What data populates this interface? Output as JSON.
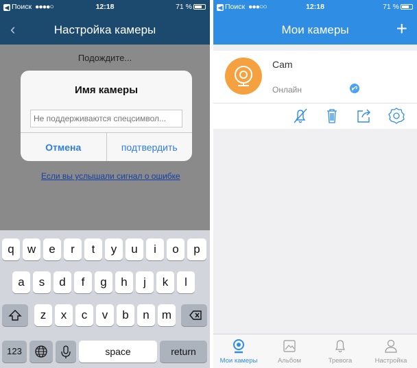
{
  "left": {
    "status": {
      "carrier_back": "Поиск",
      "signal": "●●●●○",
      "time": "12:18",
      "battery": "71 %"
    },
    "nav_title": "Настройка камеры",
    "waiting": "Подождите...",
    "dialog": {
      "title": "Имя камеры",
      "placeholder": "Не поддерживаются спецсимвол...",
      "cancel": "Отмена",
      "confirm": "подтвердить"
    },
    "error_link": "Если вы услышали сигнал о ошибке",
    "keyboard": {
      "row1": [
        "q",
        "w",
        "e",
        "r",
        "t",
        "y",
        "u",
        "i",
        "o",
        "p"
      ],
      "row2": [
        "a",
        "s",
        "d",
        "f",
        "g",
        "h",
        "j",
        "k",
        "l"
      ],
      "row3": [
        "z",
        "x",
        "c",
        "v",
        "b",
        "n",
        "m"
      ],
      "numbers": "123",
      "space": "space",
      "return": "return"
    }
  },
  "right": {
    "status": {
      "carrier_back": "Поиск",
      "signal": "●●●○○",
      "time": "12:18",
      "battery": "71 %"
    },
    "nav_title": "Мои камеры",
    "add_symbol": "+",
    "camera": {
      "name": "Cam",
      "status": "Онлайн"
    },
    "tabs": [
      {
        "label": "Мои камеры",
        "icon": "camera-icon",
        "active": true
      },
      {
        "label": "Альбом",
        "icon": "album-icon",
        "active": false
      },
      {
        "label": "Тревога",
        "icon": "bell-icon",
        "active": false
      },
      {
        "label": "Настройка",
        "icon": "user-icon",
        "active": false
      }
    ]
  },
  "colors": {
    "accent": "#2f8de4",
    "avatar": "#f5a140",
    "link": "#1440a8"
  }
}
